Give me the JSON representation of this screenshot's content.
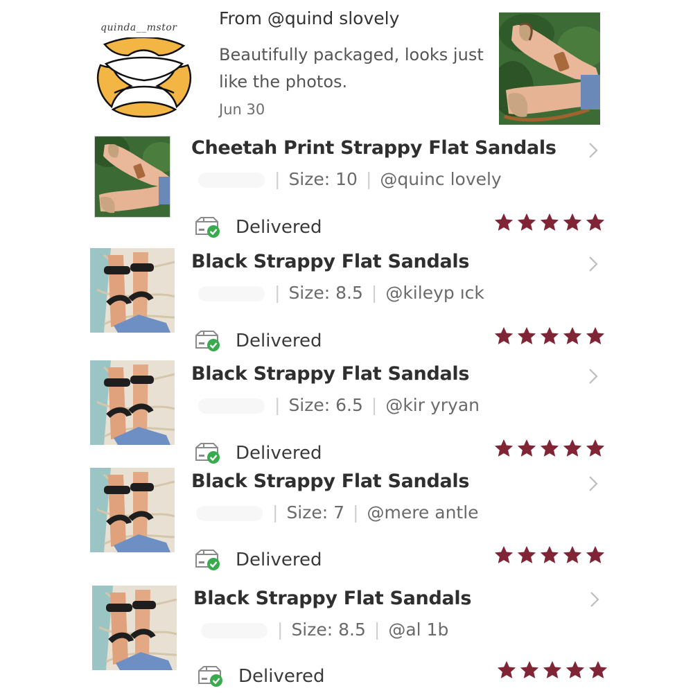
{
  "review": {
    "avatar_handle": "quinda__mstor",
    "from": "From @quind      slovely",
    "text": "Beautifully packaged, looks just like the photos.",
    "date": "Jun 30"
  },
  "orders": [
    {
      "title": "Cheetah Print Strappy Flat Sandals",
      "size": "Size: 10",
      "user": "@quinc        lovely",
      "status": "Delivered",
      "rating": 5,
      "thumb": "cheetah"
    },
    {
      "title": "Black Strappy Flat Sandals",
      "size": "Size: 8.5",
      "user": "@kileyp    ıck",
      "status": "Delivered",
      "rating": 5,
      "thumb": "black"
    },
    {
      "title": "Black Strappy Flat Sandals",
      "size": "Size: 6.5",
      "user": "@kir    yryan",
      "status": "Delivered",
      "rating": 5,
      "thumb": "black"
    },
    {
      "title": "Black Strappy Flat Sandals",
      "size": "Size: 7",
      "user": "@mere          antle",
      "status": "Delivered",
      "rating": 5,
      "thumb": "black"
    },
    {
      "title": "Black Strappy Flat Sandals",
      "size": "Size: 8.5",
      "user": "@al    1b",
      "status": "Delivered",
      "rating": 5,
      "thumb": "black"
    }
  ],
  "icons": {
    "chevron": "chevron-right-icon",
    "delivered": "delivered-box-check-icon",
    "star": "star-icon"
  },
  "colors": {
    "star": "#7f2535",
    "check": "#3aaa4e",
    "logo": "#f3b544"
  }
}
